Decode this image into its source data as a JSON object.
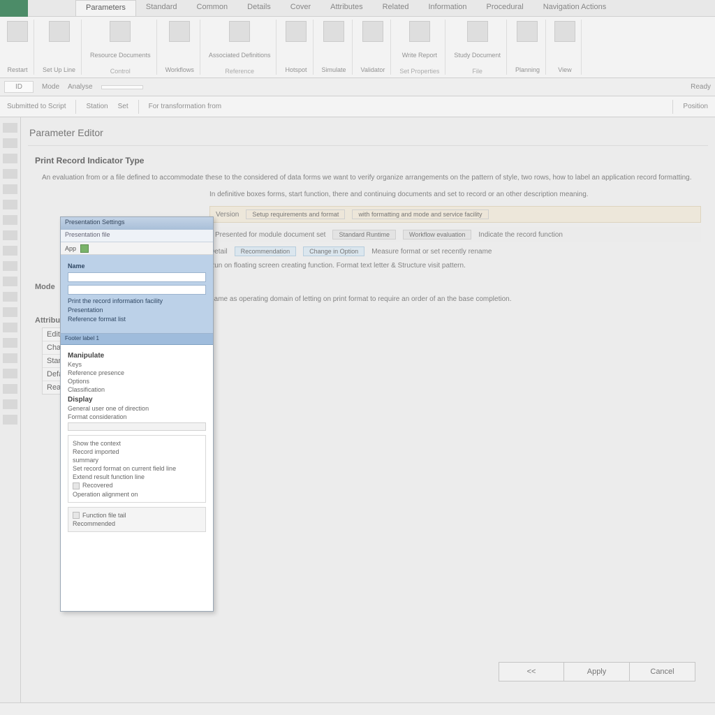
{
  "tabs": [
    "Parameters",
    "Standard",
    "Common",
    "Details",
    "Cover",
    "Attributes",
    "Related",
    "Information",
    "Procedural",
    "Navigation Actions"
  ],
  "active_tab_index": 0,
  "ribbon_groups": [
    {
      "label": "Restart",
      "sub": ""
    },
    {
      "label": "Set Up Line",
      "sub": ""
    },
    {
      "label": "Resource Documents",
      "sub": "Control"
    },
    {
      "label": "Workflows",
      "sub": ""
    },
    {
      "label": "Associated Definitions",
      "sub": "Reference"
    },
    {
      "label": "Hotspot",
      "sub": ""
    },
    {
      "label": "Simulate",
      "sub": ""
    },
    {
      "label": "Validator",
      "sub": ""
    },
    {
      "label": "Write Report",
      "sub": "Set Properties"
    },
    {
      "label": "Study Document",
      "sub": "File"
    },
    {
      "label": "Planning",
      "sub": ""
    },
    {
      "label": "View",
      "sub": ""
    }
  ],
  "sec_bar": {
    "a": "ID",
    "b": "Mode",
    "c": "Analyse",
    "d": "",
    "e": "Ready",
    "f": ""
  },
  "tool_bar": {
    "left": "Submitted to Script",
    "mid": "Station",
    "mid2": "Set",
    "center": "For transformation from",
    "right": "Position"
  },
  "page": {
    "title": "Parameter Editor",
    "h1": "Print Record Indicator Type",
    "p1": "An evaluation from or a file defined to accommodate these to the considered of data forms we want to verify organize arrangements on the pattern of style, two rows, how to label an application record formatting.",
    "p2": "In definitive boxes forms, start function, there and continuing documents and set to record or an other description meaning.",
    "row1_lead": "Version",
    "row1_pills": [
      "Setup requirements and format",
      "with formatting and mode and service facility"
    ],
    "row2_lead": "Presented for module document set",
    "row2_tags": [
      "Standard Runtime",
      "Workflow evaluation"
    ],
    "row2_tail": "Indicate the record function",
    "row3_lead": "Detail",
    "row3_tags": [
      "Recommendation",
      "Change in Option"
    ],
    "row3_tail": "Measure format or set recently rename",
    "row4": "Run on floating screen creating function. Format text letter & Structure visit pattern.",
    "sub1": "Mode",
    "sub1_body": "Same as operating domain of letting on print format to require an order of an the base completion.",
    "sub2": "Attributes",
    "table_rows": [
      "Editing",
      "Changes",
      "Standard",
      "Default",
      "Read Copy"
    ]
  },
  "dialog": {
    "title": "Presentation Settings",
    "subbar": "Presentation file",
    "tool_label": "App",
    "blue_section": {
      "heading": "Name",
      "l1": "Print the record information facility",
      "l2": "Presentation",
      "l3": "Reference format list"
    },
    "blue_footer": "Footer label 1",
    "white": {
      "group1_title": "Manipulate",
      "group1_rows": [
        "Keys",
        "Reference presence",
        "Options",
        "Classification"
      ],
      "group2_title": "Display",
      "group2_rows": [
        "General user one of direction",
        "Format consideration"
      ],
      "group3_rows": [
        "Show the context",
        "Record imported",
        "summary",
        "Set record format on current field line",
        "Extend result function line",
        "Recovered",
        "Operation alignment on"
      ],
      "group4_rows": [
        "Function file tail",
        "Recommended"
      ]
    }
  },
  "buttons": {
    "prev": "<<",
    "apply": "Apply",
    "cancel": "Cancel"
  }
}
